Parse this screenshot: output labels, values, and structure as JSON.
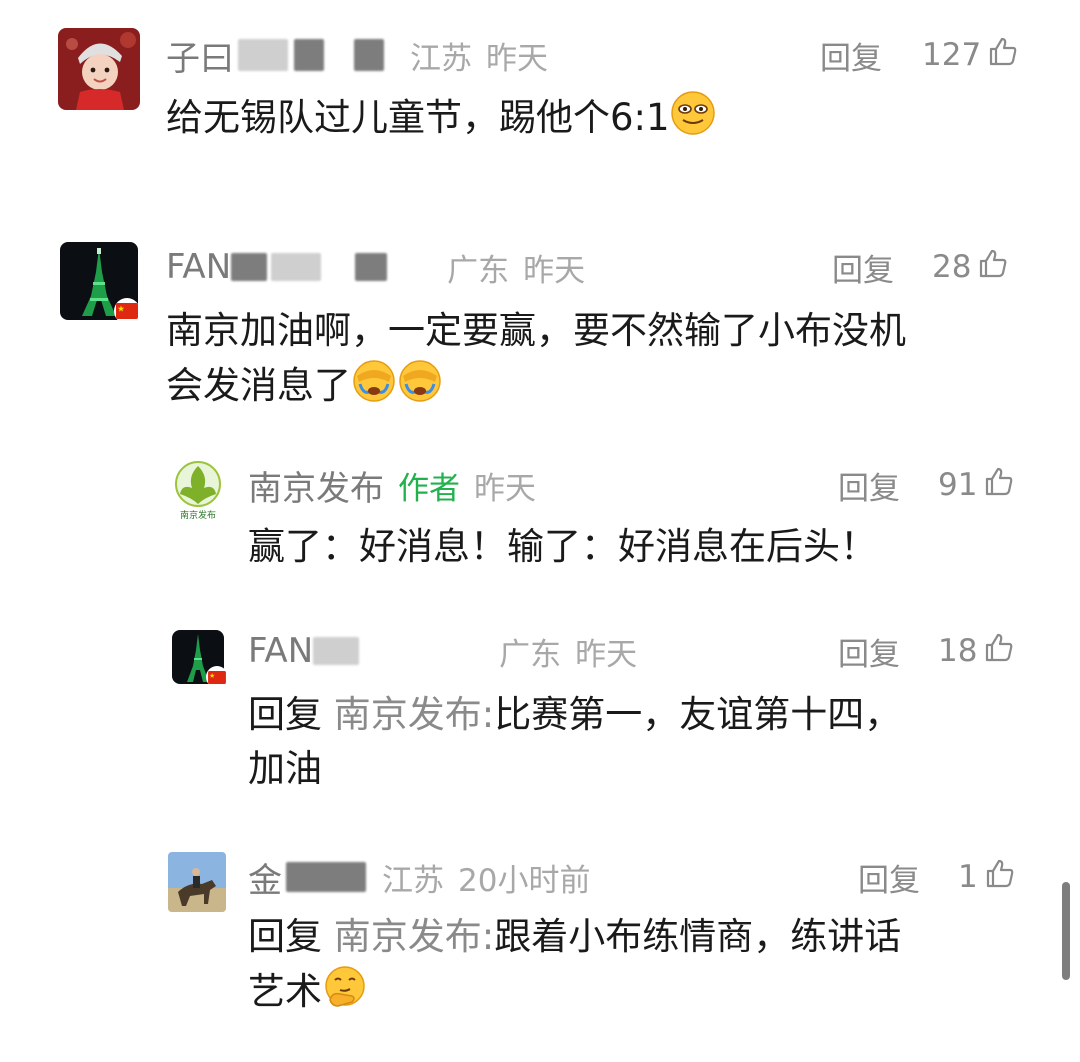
{
  "comments": [
    {
      "name_visible": "子曰",
      "location": "江苏",
      "time": "昨天",
      "reply_label": "回复",
      "likes": "127",
      "text": "给无锡队过儿童节，踢他个6:1",
      "emoji": "grinning-sweat-emoji"
    },
    {
      "name_visible": "FAN",
      "location": "广东",
      "time": "昨天",
      "reply_label": "回复",
      "likes": "28",
      "text_line1": "南京加油啊，一定要赢，要不然输了小布没机",
      "text_line2": "会发消息了",
      "emoji": "facepalm-crying-emoji"
    }
  ],
  "replies": [
    {
      "name": "南京发布",
      "author_tag": "作者",
      "time": "昨天",
      "reply_label": "回复",
      "likes": "91",
      "avatar_label": "南京发布",
      "text": "赢了：好消息！输了：好消息在后头！"
    },
    {
      "name_visible": "FAN",
      "location": "广东",
      "time": "昨天",
      "reply_label": "回复",
      "likes": "18",
      "reply_prefix": "回复",
      "mention": "南京发布:",
      "text_line1": "比赛第一，友谊第十四，",
      "text_line2": "加油"
    },
    {
      "name_visible": "金",
      "location": "江苏",
      "time": "20小时前",
      "reply_label": "回复",
      "likes": "1",
      "reply_prefix": "回复",
      "mention": "南京发布:",
      "text_line1": "跟着小布练情商，练讲话",
      "text_line2": "艺术",
      "emoji": "thinking-hand-emoji"
    }
  ],
  "colors": {
    "author_tag": "#22b14c",
    "meta_gray": "#8a8a8a",
    "text": "#1a1a1a"
  }
}
